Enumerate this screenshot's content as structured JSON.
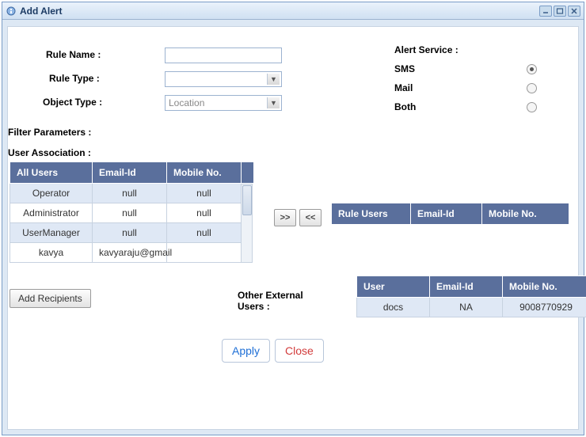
{
  "window": {
    "title": "Add Alert"
  },
  "form": {
    "ruleNameLabel": "Rule Name :",
    "ruleName": "",
    "ruleTypeLabel": "Rule Type :",
    "ruleType": "",
    "objectTypeLabel": "Object Type :",
    "objectType": "Location",
    "alertServiceLabel": "Alert Service :",
    "smsLabel": "SMS",
    "mailLabel": "Mail",
    "bothLabel": "Both"
  },
  "sections": {
    "filterParams": "Filter Parameters :",
    "userAssoc": "User Association :",
    "otherExternalUsers": "Other External Users :"
  },
  "allUsersHeaders": {
    "c1": "All Users",
    "c2": "Email-Id",
    "c3": "Mobile No."
  },
  "allUsers": [
    {
      "user": "Operator",
      "email": "null",
      "mobile": "null"
    },
    {
      "user": "Administrator",
      "email": "null",
      "mobile": "null"
    },
    {
      "user": "UserManager",
      "email": "null",
      "mobile": "null"
    },
    {
      "user": "kavya",
      "email": "kavyaraju@gmail",
      "mobile": ""
    }
  ],
  "ruleUsersHeaders": {
    "c1": "Rule Users",
    "c2": "Email-Id",
    "c3": "Mobile No."
  },
  "externalHeaders": {
    "c1": "User",
    "c2": "Email-Id",
    "c3": "Mobile No."
  },
  "externalUsers": [
    {
      "user": "docs",
      "email": "NA",
      "mobile": "9008770929"
    }
  ],
  "buttons": {
    "moveRight": ">>",
    "moveLeft": "<<",
    "addRecipients": "Add Recipients",
    "apply": "Apply",
    "close": "Close"
  }
}
